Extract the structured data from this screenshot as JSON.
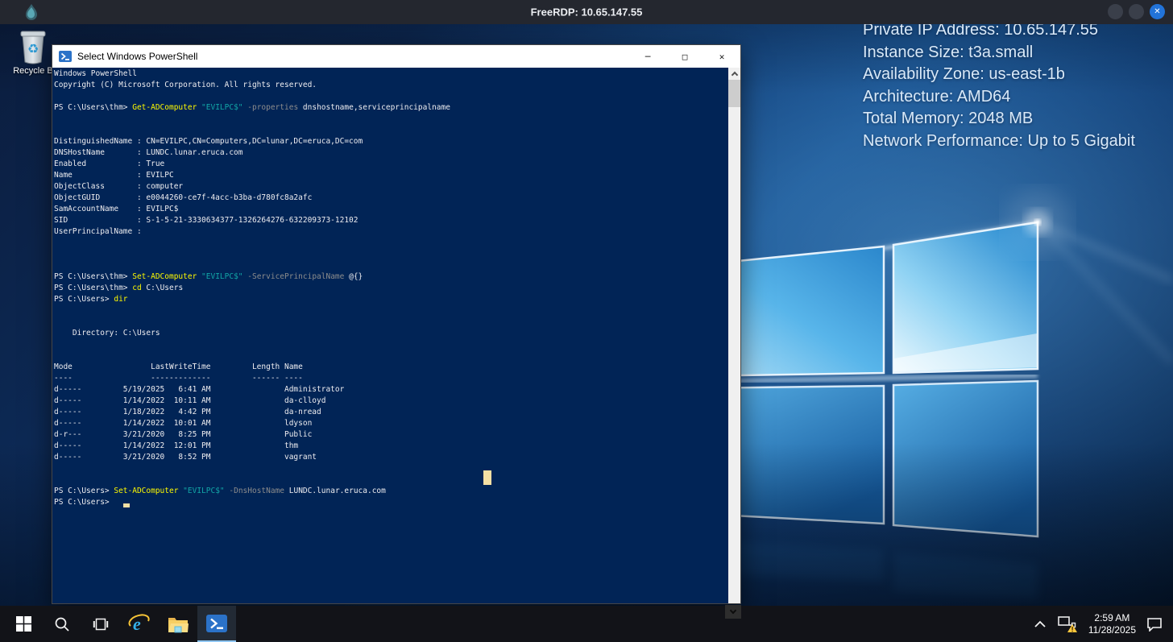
{
  "topbar": {
    "title": "FreeRDP: 10.65.147.55"
  },
  "icons": {
    "close_x": "✕",
    "recycle_symbol": "♻",
    "window_minimize": "─",
    "window_maximize": "□",
    "window_close": "✕"
  },
  "colors": {
    "topbar_bg": "#24272f",
    "close_circle": "#2273d8",
    "terminal_bg": "#012456",
    "taskbar_bg": "#121318",
    "active_task_underline": "#8fc6f2",
    "powershell_icon_blue": "#2b72c8",
    "folder_yellow": "#f7cf63",
    "ie_blue": "#35b1ea",
    "warning_yellow": "#ffc83d"
  },
  "desktop": {
    "info_lines": [
      "Private IP Address: 10.65.147.55",
      "Instance Size: t3a.small",
      "Availability Zone: us-east-1b",
      "Architecture: AMD64",
      "Total Memory: 2048 MB",
      "Network Performance: Up to 5 Gigabit"
    ],
    "recycle_bin_label": "Recycle B"
  },
  "powershell_window": {
    "title": "Select Windows PowerShell",
    "controls": {
      "minimize": "─",
      "maximize": "□",
      "close": "✕"
    }
  },
  "terminal": {
    "colors": {
      "bg": "#012456",
      "plain": "#EEEDF0",
      "cmd": "#FDF900",
      "str": "#12A7A7",
      "param": "#8C8C8C",
      "cursor": "#F3DFA4"
    },
    "lines": [
      [
        [
          "Windows PowerShell",
          "plain"
        ]
      ],
      [
        [
          "Copyright (C) Microsoft Corporation. All rights reserved.",
          "plain"
        ]
      ],
      [],
      [
        [
          "PS C:\\Users\\thm> ",
          "plain"
        ],
        [
          "Get-ADComputer",
          "cmd"
        ],
        [
          " ",
          "plain"
        ],
        [
          "\"EVILPC$\"",
          "str"
        ],
        [
          " ",
          "plain"
        ],
        [
          "-properties",
          "param"
        ],
        [
          " dnshostname,serviceprincipalname",
          "plain"
        ]
      ],
      [],
      [],
      [
        [
          "DistinguishedName : CN=EVILPC,CN=Computers,DC=lunar,DC=eruca,DC=com",
          "plain"
        ]
      ],
      [
        [
          "DNSHostName       : LUNDC.lunar.eruca.com",
          "plain"
        ]
      ],
      [
        [
          "Enabled           : True",
          "plain"
        ]
      ],
      [
        [
          "Name              : EVILPC",
          "plain"
        ]
      ],
      [
        [
          "ObjectClass       : computer",
          "plain"
        ]
      ],
      [
        [
          "ObjectGUID        : e0044260-ce7f-4acc-b3ba-d780fc8a2afc",
          "plain"
        ]
      ],
      [
        [
          "SamAccountName    : EVILPC$",
          "plain"
        ]
      ],
      [
        [
          "SID               : S-1-5-21-3330634377-1326264276-632209373-12102",
          "plain"
        ]
      ],
      [
        [
          "UserPrincipalName :",
          "plain"
        ]
      ],
      [],
      [],
      [],
      [
        [
          "PS C:\\Users\\thm> ",
          "plain"
        ],
        [
          "Set-ADComputer",
          "cmd"
        ],
        [
          " ",
          "plain"
        ],
        [
          "\"EVILPC$\"",
          "str"
        ],
        [
          " ",
          "plain"
        ],
        [
          "-ServicePrincipalName",
          "param"
        ],
        [
          " @{}",
          "plain"
        ]
      ],
      [
        [
          "PS C:\\Users\\thm> ",
          "plain"
        ],
        [
          "cd",
          "cmd"
        ],
        [
          " C:\\Users",
          "plain"
        ]
      ],
      [
        [
          "PS C:\\Users> ",
          "plain"
        ],
        [
          "dir",
          "cmd"
        ]
      ],
      [],
      [],
      [
        [
          "    Directory: C:\\Users",
          "plain"
        ]
      ],
      [],
      [],
      [
        [
          "Mode                 LastWriteTime         Length Name",
          "plain"
        ]
      ],
      [
        [
          "----                 -------------         ------ ----",
          "plain"
        ]
      ],
      [
        [
          "d-----         5/19/2025   6:41 AM                Administrator",
          "plain"
        ]
      ],
      [
        [
          "d-----         1/14/2022  10:11 AM                da-clloyd",
          "plain"
        ]
      ],
      [
        [
          "d-----         1/18/2022   4:42 PM                da-nread",
          "plain"
        ]
      ],
      [
        [
          "d-----         1/14/2022  10:01 AM                ldyson",
          "plain"
        ]
      ],
      [
        [
          "d-r---         3/21/2020   8:25 PM                Public",
          "plain"
        ]
      ],
      [
        [
          "d-----         1/14/2022  12:01 PM                thm",
          "plain"
        ]
      ],
      [
        [
          "d-----         3/21/2020   8:52 PM                vagrant",
          "plain"
        ]
      ],
      [],
      [],
      [
        [
          "PS C:\\Users> ",
          "plain"
        ],
        [
          "Set-ADComputer",
          "cmd"
        ],
        [
          " ",
          "plain"
        ],
        [
          "\"EVILPC$\"",
          "str"
        ],
        [
          " ",
          "plain"
        ],
        [
          "-DnsHostName",
          "param"
        ],
        [
          " LUNDC.lunar.eruca.com",
          "plain"
        ]
      ],
      [
        [
          "PS C:\\Users> ",
          "plain"
        ]
      ]
    ]
  },
  "taskbar": {
    "items": [
      "start",
      "search",
      "task-view",
      "internet-explorer",
      "file-explorer",
      "powershell"
    ],
    "active_item": "powershell"
  },
  "tray": {
    "time": "2:59 AM",
    "date": "11/28/2025"
  }
}
